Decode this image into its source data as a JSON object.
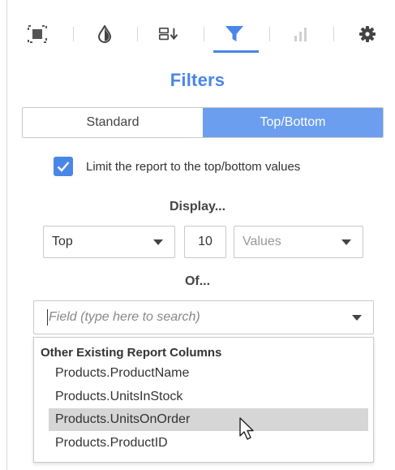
{
  "toolbar": {
    "icons": [
      "select-frame-icon",
      "droplet-icon",
      "sort-icon",
      "filter-icon",
      "bar-chart-icon",
      "gear-icon"
    ],
    "active": "filter-icon",
    "accent_color": "#4a86e8"
  },
  "panel": {
    "title": "Filters",
    "tabs": {
      "standard": "Standard",
      "top_bottom": "Top/Bottom",
      "selected": "Top/Bottom"
    },
    "limit_checkbox": {
      "checked": true,
      "label": "Limit the report to the top/bottom values"
    },
    "display_label": "Display...",
    "direction_select": "Top",
    "count_value": "10",
    "unit_select_placeholder": "Values",
    "of_label": "Of...",
    "field_search_placeholder": "Field (type here to search)"
  },
  "dropdown": {
    "group_label": "Other Existing Report Columns",
    "items": [
      "Products.ProductName",
      "Products.UnitsInStock",
      "Products.UnitsOnOrder",
      "Products.ProductID"
    ],
    "highlighted": "Products.UnitsOnOrder"
  }
}
